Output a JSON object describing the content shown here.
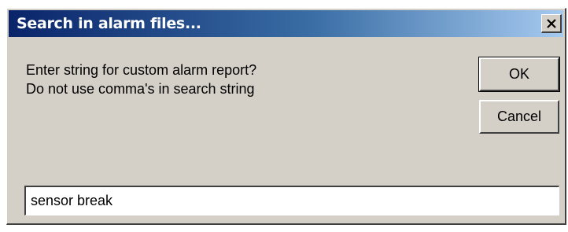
{
  "window": {
    "title": "Search in alarm files...",
    "close_icon": "close-icon"
  },
  "prompt": {
    "line1": "Enter string for custom alarm report?",
    "line2": "Do not use comma's in search string"
  },
  "buttons": {
    "ok_label": "OK",
    "cancel_label": "Cancel"
  },
  "search": {
    "value": "sensor break",
    "placeholder": ""
  },
  "colors": {
    "titlebar_start": "#0a246a",
    "titlebar_end": "#a6caf0",
    "dialog_bg": "#d4d0c8"
  }
}
